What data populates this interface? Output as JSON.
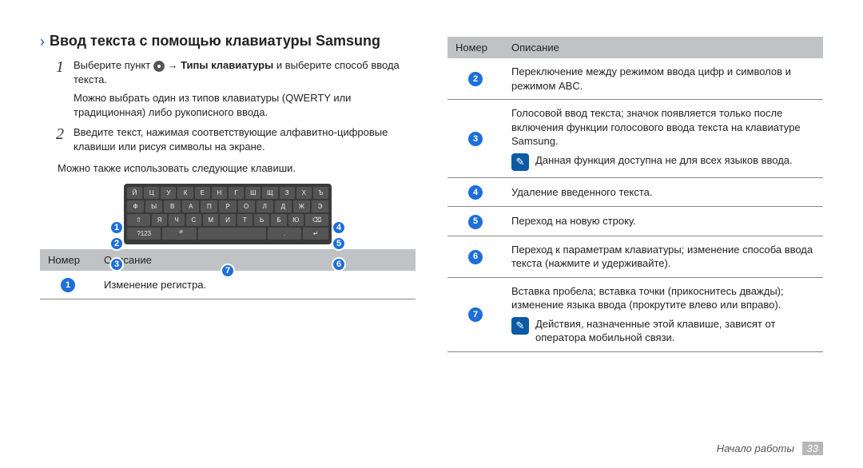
{
  "heading": "Ввод текста с помощью клавиатуры Samsung",
  "step1_a": "Выберите пункт ",
  "step1_b": " → ",
  "step1_bold": "Типы клавиатуры",
  "step1_c": " и выберите способ ввода текста.",
  "step1_sub": "Можно выбрать один из типов клавиатуры (QWERTY или традиционная) либо рукописного ввода.",
  "step2": "Введите текст, нажимая соответствующие алфавитно-цифровые клавиши или рисуя символы на экране.",
  "post_steps": "Можно также использовать следующие клавиши.",
  "keyboard_rows": [
    [
      "Й",
      "Ц",
      "У",
      "К",
      "Е",
      "Н",
      "Г",
      "Ш",
      "Щ",
      "З",
      "Х",
      "Ъ"
    ],
    [
      "Ф",
      "Ы",
      "В",
      "А",
      "П",
      "Р",
      "О",
      "Л",
      "Д",
      "Ж",
      "Э"
    ],
    [
      "⇧",
      "Я",
      "Ч",
      "С",
      "М",
      "И",
      "Т",
      "Ь",
      "Б",
      "Ю",
      "⌫"
    ],
    [
      "?123",
      "🎤",
      "␣",
      ".",
      "↵"
    ]
  ],
  "left_table": {
    "head_num": "Номер",
    "head_desc": "Описание",
    "rows": [
      {
        "n": "1",
        "text": "Изменение регистра."
      }
    ]
  },
  "right_table": {
    "head_num": "Номер",
    "head_desc": "Описание",
    "rows": [
      {
        "n": "2",
        "text": "Переключение между режимом ввода цифр и символов и режимом ABC."
      },
      {
        "n": "3",
        "text": "Голосовой ввод текста; значок появляется только после включения функции голосового ввода текста на клавиатуре Samsung.",
        "note": "Данная функция доступна не для всех языков ввода."
      },
      {
        "n": "4",
        "text": "Удаление введенного текста."
      },
      {
        "n": "5",
        "text": "Переход на новую строку."
      },
      {
        "n": "6",
        "text": "Переход к параметрам клавиатуры; изменение способа ввода текста (нажмите и удерживайте)."
      },
      {
        "n": "7",
        "text": "Вставка пробела; вставка точки (прикоснитесь дважды); изменение языка ввода (прокрутите влево или вправо).",
        "note": "Действия, назначенные этой клавише, зависят от оператора мобильной связи."
      }
    ]
  },
  "footer_section": "Начало работы",
  "footer_page": "33"
}
